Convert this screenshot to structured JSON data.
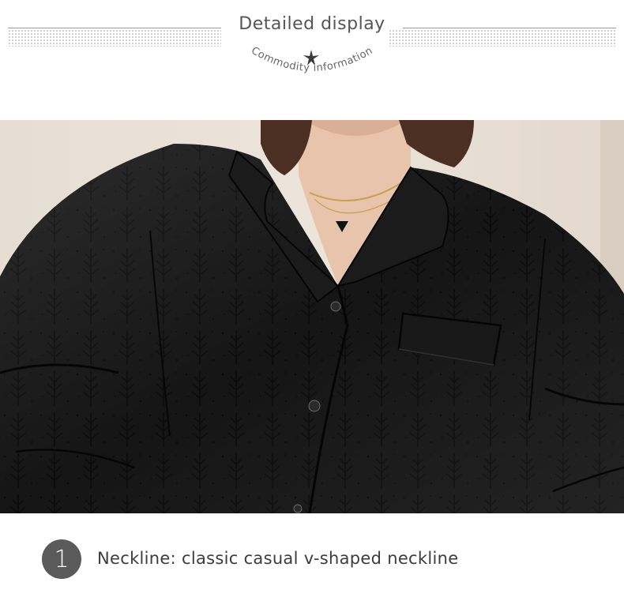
{
  "header": {
    "title": "Detailed display",
    "subtitle": "Commodity information",
    "decor_icon": "star-icon"
  },
  "photo": {
    "subject": "black-jacquard-pajama-shirt",
    "colors": {
      "fabric": "#141414",
      "background": "#e9e1d8",
      "skin": "#e8c4ad",
      "hair": "#4a2f22"
    }
  },
  "feature": {
    "number": "1",
    "text": "Neckline: classic casual v-shaped neckline"
  }
}
